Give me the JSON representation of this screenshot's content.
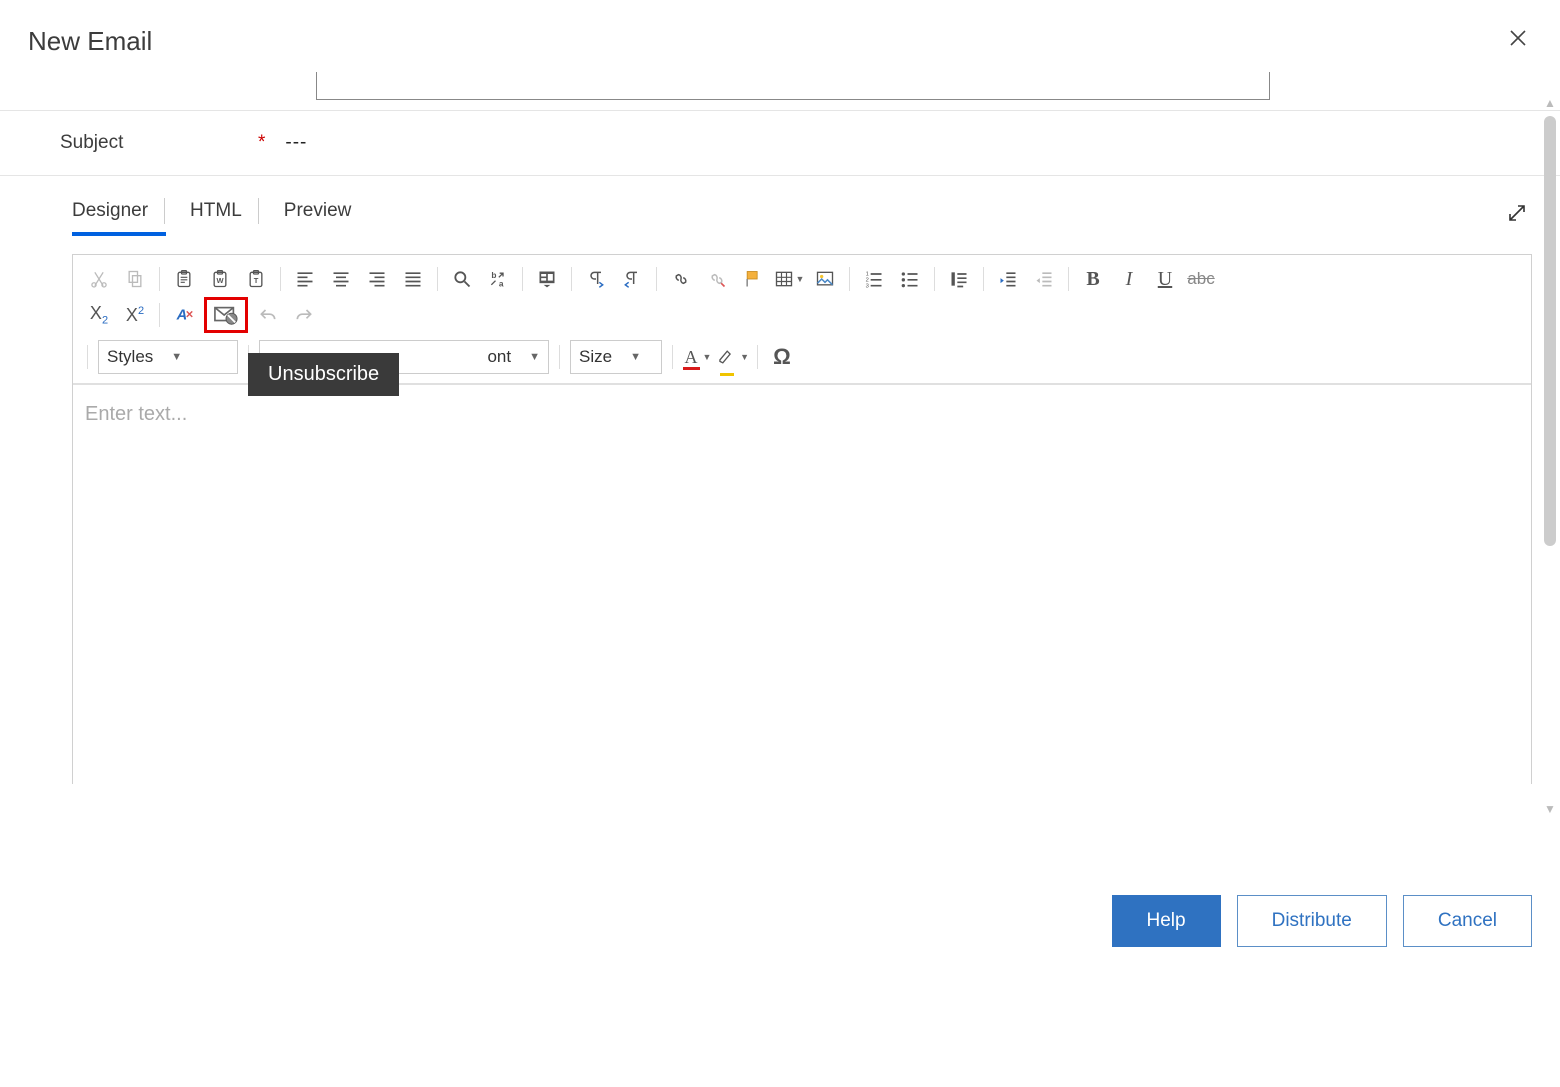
{
  "header": {
    "title": "New Email"
  },
  "subject": {
    "label": "Subject",
    "required": "*",
    "value": "---"
  },
  "tabs": {
    "designer": "Designer",
    "html": "HTML",
    "preview": "Preview"
  },
  "tooltip": {
    "unsubscribe": "Unsubscribe"
  },
  "dropdowns": {
    "styles": "Styles",
    "font_partial": "ont",
    "size": "Size"
  },
  "editor": {
    "placeholder": "Enter text..."
  },
  "footer": {
    "help": "Help",
    "distribute": "Distribute",
    "cancel": "Cancel"
  }
}
